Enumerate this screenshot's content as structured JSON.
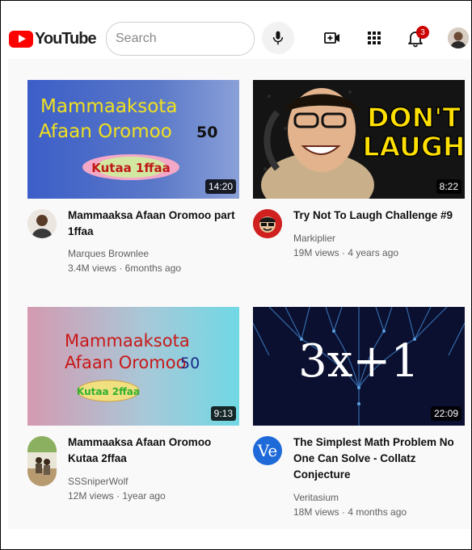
{
  "header": {
    "logo_text": "YouTube",
    "search_placeholder": "Search",
    "notification_count": "3"
  },
  "videos": [
    {
      "thumb_text_line1": "Mammaaksota",
      "thumb_text_line2": "Afaan Oromoo",
      "thumb_number": "50",
      "thumb_pill": "Kutaa 1ffaa",
      "duration": "14:20",
      "title_line1": "Mammaaksa Afaan Oromoo part",
      "title_line2": "1ffaa",
      "channel": "Marques Brownlee",
      "meta": "3.4M views · 6months ago"
    },
    {
      "thumb_text_line1": "DON'T",
      "thumb_text_line2": "LAUGH",
      "duration": "8:22",
      "title_line1": "Try Not To Laugh Challenge #9",
      "channel": "Markiplier",
      "meta": "19M views · 4 years ago"
    },
    {
      "thumb_text_line1": "Mammaaksota",
      "thumb_text_line2": "Afaan Oromoo",
      "thumb_number": "50",
      "thumb_pill": "Kutaa 2ffaa",
      "duration": "9:13",
      "title_line1": "Mammaaksa Afaan Oromoo",
      "title_line2": "Kutaa 2ffaa",
      "channel": "SSSniperWolf",
      "meta": "12M views · 1year ago"
    },
    {
      "thumb_text": "3x+1",
      "duration": "22:09",
      "title_line1": "The Simplest Math Problem No",
      "title_line2": "One Can Solve - Collatz",
      "title_line3": "Conjecture",
      "channel": "Veritasium",
      "channel_avatar_text": "Ve",
      "meta": "18M views · 4 months ago"
    }
  ],
  "colors": {
    "brand_red": "#ff0000",
    "badge_red": "#cc0000",
    "thumb1_text": "#f0e020",
    "thumb3_text": "#c01818",
    "laugh_yellow": "#ffe000"
  }
}
